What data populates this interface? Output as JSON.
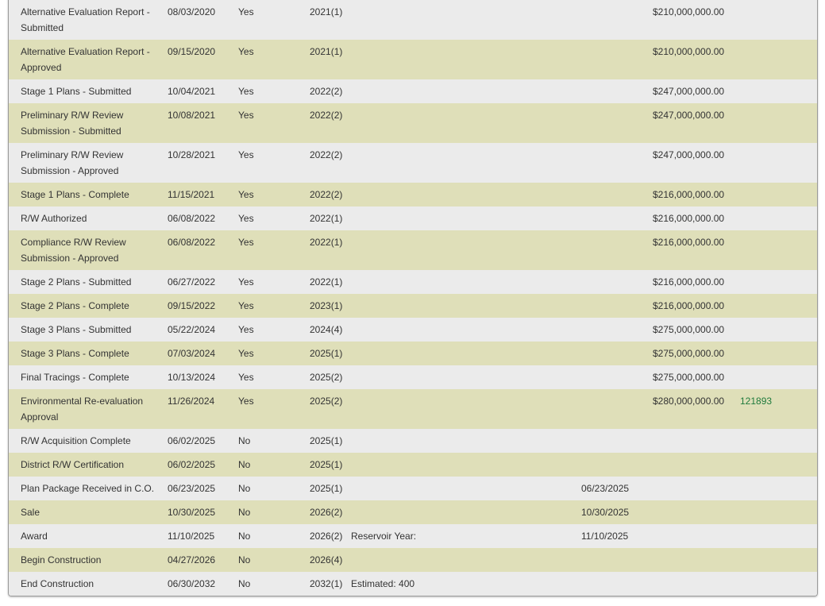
{
  "rows": [
    {
      "name": "Alternative Evaluation Report - Submitted",
      "date": "08/03/2020",
      "done": "Yes",
      "year": "2021(1)",
      "note": "",
      "alt_date": "",
      "cost": "$210,000,000.00",
      "ids": ""
    },
    {
      "name": "Alternative Evaluation Report - Approved",
      "date": "09/15/2020",
      "done": "Yes",
      "year": "2021(1)",
      "note": "",
      "alt_date": "",
      "cost": "$210,000,000.00",
      "ids": ""
    },
    {
      "name": "Stage 1 Plans - Submitted",
      "date": "10/04/2021",
      "done": "Yes",
      "year": "2022(2)",
      "note": "",
      "alt_date": "",
      "cost": "$247,000,000.00",
      "ids": ""
    },
    {
      "name": "Preliminary R/W Review Submission - Submitted",
      "date": "10/08/2021",
      "done": "Yes",
      "year": "2022(2)",
      "note": "",
      "alt_date": "",
      "cost": "$247,000,000.00",
      "ids": ""
    },
    {
      "name": "Preliminary R/W Review Submission - Approved",
      "date": "10/28/2021",
      "done": "Yes",
      "year": "2022(2)",
      "note": "",
      "alt_date": "",
      "cost": "$247,000,000.00",
      "ids": ""
    },
    {
      "name": "Stage 1 Plans - Complete",
      "date": "11/15/2021",
      "done": "Yes",
      "year": "2022(2)",
      "note": "",
      "alt_date": "",
      "cost": "$216,000,000.00",
      "ids": ""
    },
    {
      "name": "R/W Authorized",
      "date": "06/08/2022",
      "done": "Yes",
      "year": "2022(1)",
      "note": "",
      "alt_date": "",
      "cost": "$216,000,000.00",
      "ids": ""
    },
    {
      "name": "Compliance R/W Review Submission - Approved",
      "date": "06/08/2022",
      "done": "Yes",
      "year": "2022(1)",
      "note": "",
      "alt_date": "",
      "cost": "$216,000,000.00",
      "ids": ""
    },
    {
      "name": "Stage 2 Plans - Submitted",
      "date": "06/27/2022",
      "done": "Yes",
      "year": "2022(1)",
      "note": "",
      "alt_date": "",
      "cost": "$216,000,000.00",
      "ids": ""
    },
    {
      "name": "Stage 2 Plans - Complete",
      "date": "09/15/2022",
      "done": "Yes",
      "year": "2023(1)",
      "note": "",
      "alt_date": "",
      "cost": "$216,000,000.00",
      "ids": ""
    },
    {
      "name": "Stage 3 Plans - Submitted",
      "date": "05/22/2024",
      "done": "Yes",
      "year": "2024(4)",
      "note": "",
      "alt_date": "",
      "cost": "$275,000,000.00",
      "ids": ""
    },
    {
      "name": "Stage 3 Plans - Complete",
      "date": "07/03/2024",
      "done": "Yes",
      "year": "2025(1)",
      "note": "",
      "alt_date": "",
      "cost": "$275,000,000.00",
      "ids": ""
    },
    {
      "name": "Final Tracings - Complete",
      "date": "10/13/2024",
      "done": "Yes",
      "year": "2025(2)",
      "note": "",
      "alt_date": "",
      "cost": "$275,000,000.00",
      "ids": ""
    },
    {
      "name": "Environmental Re-evaluation Approval",
      "date": "11/26/2024",
      "done": "Yes",
      "year": "2025(2)",
      "note": "",
      "alt_date": "",
      "cost": "$280,000,000.00",
      "ids": "121893"
    },
    {
      "name": "R/W Acquisition Complete",
      "date": "06/02/2025",
      "done": "No",
      "year": "2025(1)",
      "note": "",
      "alt_date": "",
      "cost": "",
      "ids": ""
    },
    {
      "name": "District R/W Certification",
      "date": "06/02/2025",
      "done": "No",
      "year": "2025(1)",
      "note": "",
      "alt_date": "",
      "cost": "",
      "ids": ""
    },
    {
      "name": "Plan Package Received in C.O.",
      "date": "06/23/2025",
      "done": "No",
      "year": "2025(1)",
      "note": "",
      "alt_date": "06/23/2025",
      "cost": "",
      "ids": ""
    },
    {
      "name": "Sale",
      "date": "10/30/2025",
      "done": "No",
      "year": "2026(2)",
      "note": "",
      "alt_date": "10/30/2025",
      "cost": "",
      "ids": ""
    },
    {
      "name": "Award",
      "date": "11/10/2025",
      "done": "No",
      "year": "2026(2)",
      "note": "Reservoir Year:",
      "alt_date": "11/10/2025",
      "cost": "",
      "ids": ""
    },
    {
      "name": "Begin Construction",
      "date": "04/27/2026",
      "done": "No",
      "year": "2026(4)",
      "note": "",
      "alt_date": "",
      "cost": "",
      "ids": ""
    },
    {
      "name": "End Construction",
      "date": "06/30/2032",
      "done": "No",
      "year": "2032(1)",
      "note": "Estimated: 400",
      "alt_date": "",
      "cost": "",
      "ids": ""
    }
  ]
}
